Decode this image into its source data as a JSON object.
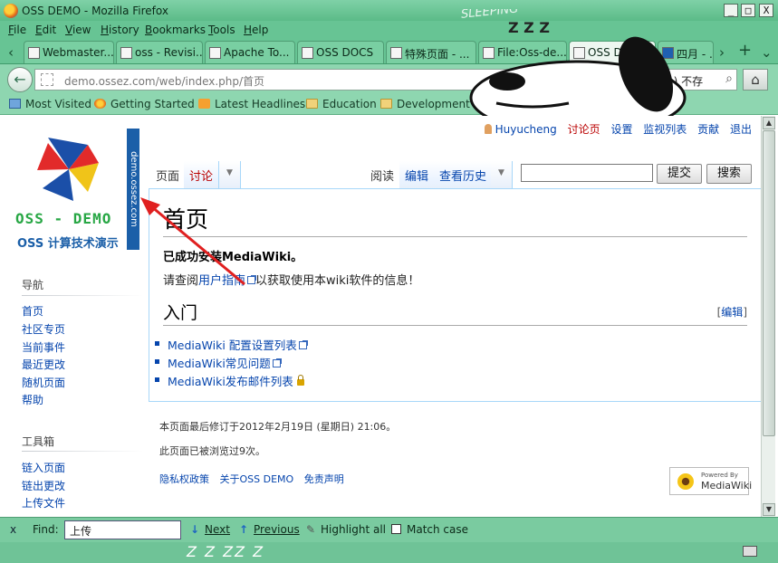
{
  "window": {
    "title": "OSS DEMO - Mozilla Firefox",
    "buttons": {
      "minimize": "_",
      "maximize": "□",
      "close": "X"
    }
  },
  "menubar": [
    "File",
    "Edit",
    "View",
    "History",
    "Bookmarks",
    "Tools",
    "Help"
  ],
  "decoration": {
    "banner_text": "SNOOP SLEEPING",
    "zzz": "Z Z Z"
  },
  "tabs": [
    {
      "label": "Webmaster..."
    },
    {
      "label": "oss - Revisi..."
    },
    {
      "label": "Apache To..."
    },
    {
      "label": "OSS DOCS"
    },
    {
      "label": "特殊页面 - ..."
    },
    {
      "label": "File:Oss-de..."
    },
    {
      "label": "OSS DE..."
    },
    {
      "label": "四月 - ..."
    }
  ],
  "tabstrip": {
    "scroll_left": "‹",
    "scroll_right": "›",
    "new_tab": "+",
    "list_all": "⌄"
  },
  "navbar": {
    "back": "←",
    "url": "demo.ossez.com/web/index.php/首页",
    "star": "☆",
    "reload": "C",
    "search_text": "( public) 不存",
    "search_go": "⌕",
    "home": "⌂"
  },
  "bookmarks": [
    "Most Visited",
    "Getting Started",
    "Latest Headlines",
    "Education",
    "Development"
  ],
  "page": {
    "personal": {
      "user": "Huyucheng",
      "talk": "讨论页",
      "prefs": "设置",
      "watchlist": "监视列表",
      "contrib": "贡献",
      "logout": "退出"
    },
    "logo": {
      "vertical": "demo.ossez.com",
      "title": "OSS - DEMO",
      "subtitle": "OSS 计算技术演示"
    },
    "sidebar": {
      "nav_heading": "导航",
      "nav": [
        "首页",
        "社区专页",
        "当前事件",
        "最近更改",
        "随机页面",
        "帮助"
      ],
      "tools_heading": "工具箱",
      "tools": [
        "链入页面",
        "链出更改",
        "上传文件"
      ]
    },
    "tabs": {
      "page": "页面",
      "discussion": "讨论",
      "read": "阅读",
      "edit": "编辑",
      "history": "查看历史",
      "dropdown": "▼"
    },
    "search": {
      "go": "提交",
      "search": "搜索"
    },
    "heading": "首页",
    "installed": "已成功安装MediaWiki。",
    "guide": {
      "prefix": "请查阅",
      "link": "用户指南",
      "suffix": "以获取使用本wiki软件的信息！"
    },
    "section": "入门",
    "edit_section": {
      "open": "[",
      "link": "编辑",
      "close": "]"
    },
    "list": [
      "MediaWiki 配置设置列表",
      "MediaWiki常见问题",
      "MediaWiki发布邮件列表"
    ],
    "footer": {
      "modified": "本页面最后修订于2012年2月19日 (星期日) 21:06。",
      "views": "此页面已被浏览过9次。",
      "links": [
        "隐私权政策",
        "关于OSS DEMO",
        "免责声明"
      ]
    },
    "powered": {
      "small": "Powered By",
      "name": "MediaWiki"
    }
  },
  "findbar": {
    "close": "x",
    "label": "Find:",
    "value": "上传",
    "next": "Next",
    "previous": "Previous",
    "highlight": "Highlight all",
    "match_case": "Match case"
  },
  "statusbar": {
    "text": "Z Z ZZ Z"
  }
}
